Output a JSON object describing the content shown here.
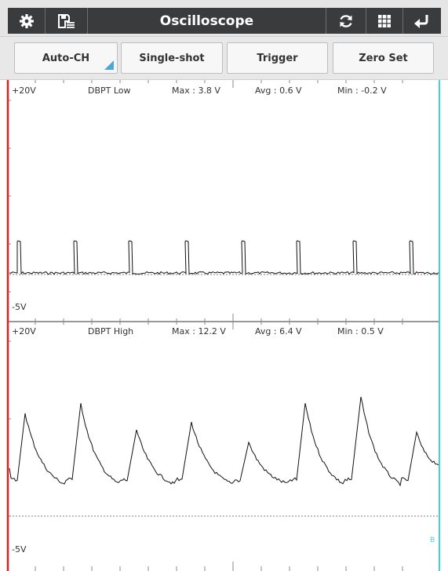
{
  "header": {
    "title": "Oscilloscope",
    "buttons": [
      {
        "name": "settings",
        "icon": "gear-icon"
      },
      {
        "name": "save",
        "icon": "save-list-icon"
      },
      {
        "name": "refresh",
        "icon": "refresh-icon"
      },
      {
        "name": "grid",
        "icon": "grid-icon"
      },
      {
        "name": "back",
        "icon": "return-arrow-icon"
      }
    ]
  },
  "controls": {
    "auto_ch": "Auto-CH",
    "single_shot": "Single-shot",
    "trigger": "Trigger",
    "zero_set": "Zero Set"
  },
  "channels": [
    {
      "name": "DBPT Low",
      "max": "Max : 3.8 V",
      "avg": "Avg : 0.6 V",
      "min": "Min : -0.2 V",
      "top_scale": "+20V",
      "bottom_scale": "-5V"
    },
    {
      "name": "DBPT High",
      "max": "Max : 12.2 V",
      "avg": "Avg : 6.4 V",
      "min": "Min : 0.5 V",
      "top_scale": "+20V",
      "bottom_scale": "-5V"
    }
  ],
  "cursor_marker": "B",
  "colors": {
    "header_bg": "#3a3b3d",
    "left_cursor": "#e02020",
    "right_cursor": "#3ad6e0",
    "trace": "#111111",
    "button_corner": "#4aa8d8"
  }
}
